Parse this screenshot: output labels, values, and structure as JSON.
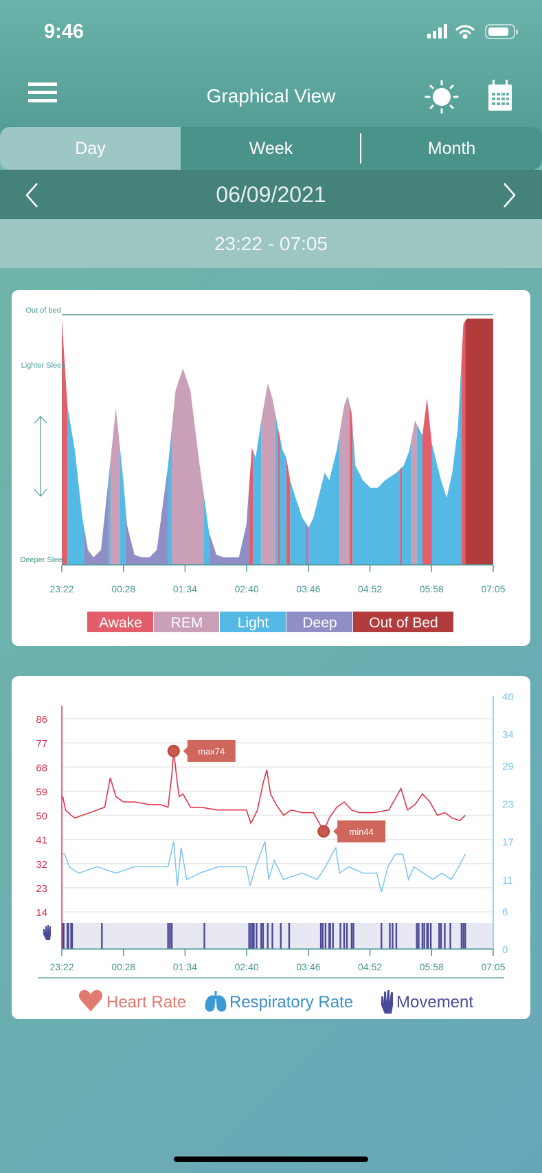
{
  "status": {
    "time": "9:46"
  },
  "header": {
    "title": "Graphical View",
    "menu_icon": "hamburger-icon",
    "sun_icon": "sun-icon",
    "calendar_icon": "calendar-icon"
  },
  "tabs": [
    {
      "label": "Day",
      "active": true
    },
    {
      "label": "Week",
      "active": false
    },
    {
      "label": "Month",
      "active": false
    }
  ],
  "date": "06/09/2021",
  "range": "23:22 - 07:05",
  "colors": {
    "awake": "#e35d6a",
    "rem": "#c9a0b8",
    "light": "#55b9e6",
    "deep": "#8f8fc6",
    "out": "#b23b3b",
    "hr": "#e2334a",
    "resp": "#7cc4f0",
    "movement": "#4b4a9a",
    "axis": "#4a9a92"
  },
  "chart_data": [
    {
      "type": "area",
      "y_labels": {
        "top": "Out of bed",
        "lighter": "Lighter Sleep",
        "deeper": "Deeper Sleep"
      },
      "x_ticks": [
        "23:22",
        "00:28",
        "01:34",
        "02:40",
        "03:46",
        "04:52",
        "05:58",
        "07:05"
      ],
      "legend": [
        {
          "key": "awake",
          "label": "Awake"
        },
        {
          "key": "rem",
          "label": "REM"
        },
        {
          "key": "light",
          "label": "Light"
        },
        {
          "key": "deep",
          "label": "Deep"
        },
        {
          "key": "out",
          "label": "Out of Bed"
        }
      ],
      "depth_scale": "0 = Deeper Sleep, 100 = Out of bed",
      "curve": [
        [
          "23:22",
          99
        ],
        [
          "23:28",
          64
        ],
        [
          "23:36",
          46
        ],
        [
          "23:44",
          19
        ],
        [
          "23:50",
          6
        ],
        [
          "23:56",
          3
        ],
        [
          "00:04",
          6
        ],
        [
          "00:12",
          34
        ],
        [
          "00:20",
          63
        ],
        [
          "00:28",
          34
        ],
        [
          "00:32",
          16
        ],
        [
          "00:40",
          4
        ],
        [
          "00:48",
          3
        ],
        [
          "00:56",
          3
        ],
        [
          "01:04",
          6
        ],
        [
          "01:16",
          40
        ],
        [
          "01:24",
          70
        ],
        [
          "01:32",
          79
        ],
        [
          "01:40",
          70
        ],
        [
          "01:50",
          40
        ],
        [
          "02:00",
          13
        ],
        [
          "02:08",
          4
        ],
        [
          "02:16",
          3
        ],
        [
          "02:32",
          3
        ],
        [
          "02:40",
          16
        ],
        [
          "02:46",
          47
        ],
        [
          "02:50",
          43
        ],
        [
          "02:56",
          58
        ],
        [
          "03:03",
          73
        ],
        [
          "03:08",
          67
        ],
        [
          "03:14",
          55
        ],
        [
          "03:19",
          46
        ],
        [
          "03:23",
          43
        ],
        [
          "03:27",
          34
        ],
        [
          "03:32",
          28
        ],
        [
          "03:40",
          19
        ],
        [
          "03:47",
          15
        ],
        [
          "03:52",
          19
        ],
        [
          "04:00",
          31
        ],
        [
          "04:04",
          37
        ],
        [
          "04:09",
          34
        ],
        [
          "04:17",
          46
        ],
        [
          "04:25",
          64
        ],
        [
          "04:29",
          68
        ],
        [
          "04:33",
          61
        ],
        [
          "04:37",
          40
        ],
        [
          "04:45",
          34
        ],
        [
          "04:53",
          31
        ],
        [
          "05:01",
          31
        ],
        [
          "05:09",
          34
        ],
        [
          "05:21",
          37
        ],
        [
          "05:29",
          40
        ],
        [
          "05:35",
          46
        ],
        [
          "05:41",
          58
        ],
        [
          "05:45",
          55
        ],
        [
          "05:49",
          52
        ],
        [
          "05:54",
          67
        ],
        [
          "05:59",
          49
        ],
        [
          "06:09",
          34
        ],
        [
          "06:15",
          27
        ],
        [
          "06:21",
          37
        ],
        [
          "06:27",
          55
        ],
        [
          "06:33",
          97
        ],
        [
          "06:37",
          99
        ],
        [
          "07:05",
          99
        ]
      ],
      "stages": [
        [
          "23:22",
          "23:28",
          "awake"
        ],
        [
          "23:28",
          "23:46",
          "light"
        ],
        [
          "23:46",
          "00:12",
          "deep"
        ],
        [
          "00:12",
          "00:14",
          "light"
        ],
        [
          "00:14",
          "00:24",
          "rem"
        ],
        [
          "00:24",
          "00:30",
          "light"
        ],
        [
          "00:30",
          "01:16",
          "deep"
        ],
        [
          "01:16",
          "01:20",
          "light"
        ],
        [
          "01:20",
          "01:54",
          "rem"
        ],
        [
          "01:54",
          "02:00",
          "light"
        ],
        [
          "02:00",
          "02:43",
          "deep"
        ],
        [
          "02:43",
          "02:47",
          "awake"
        ],
        [
          "02:47",
          "02:56",
          "light"
        ],
        [
          "02:56",
          "03:11",
          "rem"
        ],
        [
          "03:11",
          "03:14",
          "light"
        ],
        [
          "03:14",
          "03:16",
          "awake"
        ],
        [
          "03:16",
          "03:23",
          "light"
        ],
        [
          "03:23",
          "03:27",
          "awake"
        ],
        [
          "03:27",
          "03:43",
          "light"
        ],
        [
          "03:43",
          "03:48",
          "deep"
        ],
        [
          "03:48",
          "04:20",
          "light"
        ],
        [
          "04:20",
          "04:31",
          "rem"
        ],
        [
          "04:31",
          "04:34",
          "awake"
        ],
        [
          "04:34",
          "05:25",
          "light"
        ],
        [
          "05:25",
          "05:27",
          "awake"
        ],
        [
          "05:27",
          "05:37",
          "light"
        ],
        [
          "05:37",
          "05:43",
          "rem"
        ],
        [
          "05:43",
          "05:49",
          "light"
        ],
        [
          "05:49",
          "05:59",
          "awake"
        ],
        [
          "05:59",
          "06:31",
          "light"
        ],
        [
          "06:31",
          "06:35",
          "awake"
        ],
        [
          "06:35",
          "07:05",
          "out"
        ]
      ]
    },
    {
      "type": "line",
      "x_ticks": [
        "23:22",
        "00:28",
        "01:34",
        "02:40",
        "03:46",
        "04:52",
        "05:58",
        "07:05"
      ],
      "left_ticks": [
        14,
        23,
        32,
        41,
        50,
        59,
        68,
        77,
        86
      ],
      "right_ticks": [
        0,
        6,
        11,
        17,
        23,
        29,
        34,
        40
      ],
      "left_range": [
        14,
        86
      ],
      "right_range": [
        0,
        40
      ],
      "annotations": {
        "max": {
          "label": "max74",
          "time": "01:22",
          "value": 74
        },
        "min": {
          "label": "min44",
          "time": "04:03",
          "value": 44
        }
      },
      "series": [
        {
          "name": "Heart Rate",
          "key": "hr",
          "axis": "left",
          "points": [
            [
              "23:23",
              57
            ],
            [
              "23:26",
              52
            ],
            [
              "23:32",
              50
            ],
            [
              "23:36",
              49
            ],
            [
              "23:44",
              50
            ],
            [
              "23:52",
              51
            ],
            [
              "00:00",
              52
            ],
            [
              "00:08",
              53
            ],
            [
              "00:14",
              64
            ],
            [
              "00:20",
              57
            ],
            [
              "00:28",
              55
            ],
            [
              "00:40",
              55
            ],
            [
              "00:56",
              54
            ],
            [
              "01:08",
              54
            ],
            [
              "01:16",
              53
            ],
            [
              "01:20",
              65
            ],
            [
              "01:22",
              74
            ],
            [
              "01:26",
              62
            ],
            [
              "01:28",
              57
            ],
            [
              "01:32",
              58
            ],
            [
              "01:40",
              53
            ],
            [
              "01:52",
              53
            ],
            [
              "02:08",
              52
            ],
            [
              "02:24",
              52
            ],
            [
              "02:40",
              52
            ],
            [
              "02:45",
              47
            ],
            [
              "02:52",
              52
            ],
            [
              "02:58",
              62
            ],
            [
              "03:02",
              67
            ],
            [
              "03:06",
              58
            ],
            [
              "03:12",
              54
            ],
            [
              "03:20",
              50
            ],
            [
              "03:28",
              52
            ],
            [
              "03:40",
              51
            ],
            [
              "03:52",
              51
            ],
            [
              "04:00",
              46
            ],
            [
              "04:03",
              44
            ],
            [
              "04:09",
              49
            ],
            [
              "04:17",
              53
            ],
            [
              "04:25",
              55
            ],
            [
              "04:33",
              52
            ],
            [
              "04:41",
              51
            ],
            [
              "04:57",
              51
            ],
            [
              "05:13",
              52
            ],
            [
              "05:26",
              60
            ],
            [
              "05:33",
              52
            ],
            [
              "05:41",
              54
            ],
            [
              "05:49",
              58
            ],
            [
              "05:57",
              55
            ],
            [
              "06:05",
              50
            ],
            [
              "06:13",
              51
            ],
            [
              "06:21",
              49
            ],
            [
              "06:29",
              48
            ],
            [
              "06:35",
              50
            ]
          ]
        },
        {
          "name": "Respiratory Rate",
          "key": "resp",
          "axis": "right",
          "points": [
            [
              "23:23",
              15
            ],
            [
              "23:25",
              15
            ],
            [
              "23:30",
              13
            ],
            [
              "23:40",
              12
            ],
            [
              "00:00",
              13
            ],
            [
              "00:20",
              12
            ],
            [
              "00:40",
              13
            ],
            [
              "01:00",
              13
            ],
            [
              "01:16",
              13
            ],
            [
              "01:22",
              17
            ],
            [
              "01:26",
              10
            ],
            [
              "01:30",
              16
            ],
            [
              "01:36",
              11
            ],
            [
              "01:50",
              12
            ],
            [
              "02:10",
              13
            ],
            [
              "02:30",
              13
            ],
            [
              "02:40",
              13
            ],
            [
              "02:44",
              10
            ],
            [
              "02:50",
              13
            ],
            [
              "03:00",
              17
            ],
            [
              "03:04",
              11
            ],
            [
              "03:10",
              14
            ],
            [
              "03:20",
              11
            ],
            [
              "03:40",
              12
            ],
            [
              "03:56",
              11
            ],
            [
              "04:05",
              13
            ],
            [
              "04:12",
              15
            ],
            [
              "04:16",
              16
            ],
            [
              "04:20",
              12
            ],
            [
              "04:30",
              13
            ],
            [
              "04:45",
              12
            ],
            [
              "05:00",
              12
            ],
            [
              "05:05",
              9
            ],
            [
              "05:12",
              13
            ],
            [
              "05:20",
              15
            ],
            [
              "05:28",
              15
            ],
            [
              "05:34",
              11
            ],
            [
              "05:40",
              13
            ],
            [
              "05:50",
              12
            ],
            [
              "06:00",
              11
            ],
            [
              "06:10",
              12
            ],
            [
              "06:20",
              11
            ],
            [
              "06:28",
              13
            ],
            [
              "06:35",
              15
            ]
          ]
        },
        {
          "name": "Movement",
          "key": "movement",
          "events": [
            "23:23",
            "23:24",
            "23:28",
            "23:29",
            "23:32",
            "23:33",
            "00:05",
            "01:16",
            "01:18",
            "01:20",
            "01:55",
            "02:43",
            "02:45",
            "02:47",
            "02:48",
            "02:51",
            "02:56",
            "02:58",
            "03:03",
            "03:08",
            "03:17",
            "03:26",
            "04:00",
            "04:02",
            "04:05",
            "04:09",
            "04:10",
            "04:13",
            "04:21",
            "04:25",
            "04:28",
            "04:33",
            "04:35",
            "05:05",
            "05:14",
            "05:17",
            "05:21",
            "05:43",
            "05:45",
            "05:49",
            "05:51",
            "05:54",
            "05:55",
            "05:58",
            "06:07",
            "06:09",
            "06:13",
            "06:19",
            "06:31",
            "06:33",
            "06:35"
          ]
        }
      ],
      "legend": [
        {
          "key": "hr",
          "label": "Heart Rate",
          "icon": "heart-icon"
        },
        {
          "key": "resp",
          "label": "Respiratory Rate",
          "icon": "lungs-icon"
        },
        {
          "key": "movement",
          "label": "Movement",
          "icon": "hand-icon"
        }
      ]
    }
  ]
}
